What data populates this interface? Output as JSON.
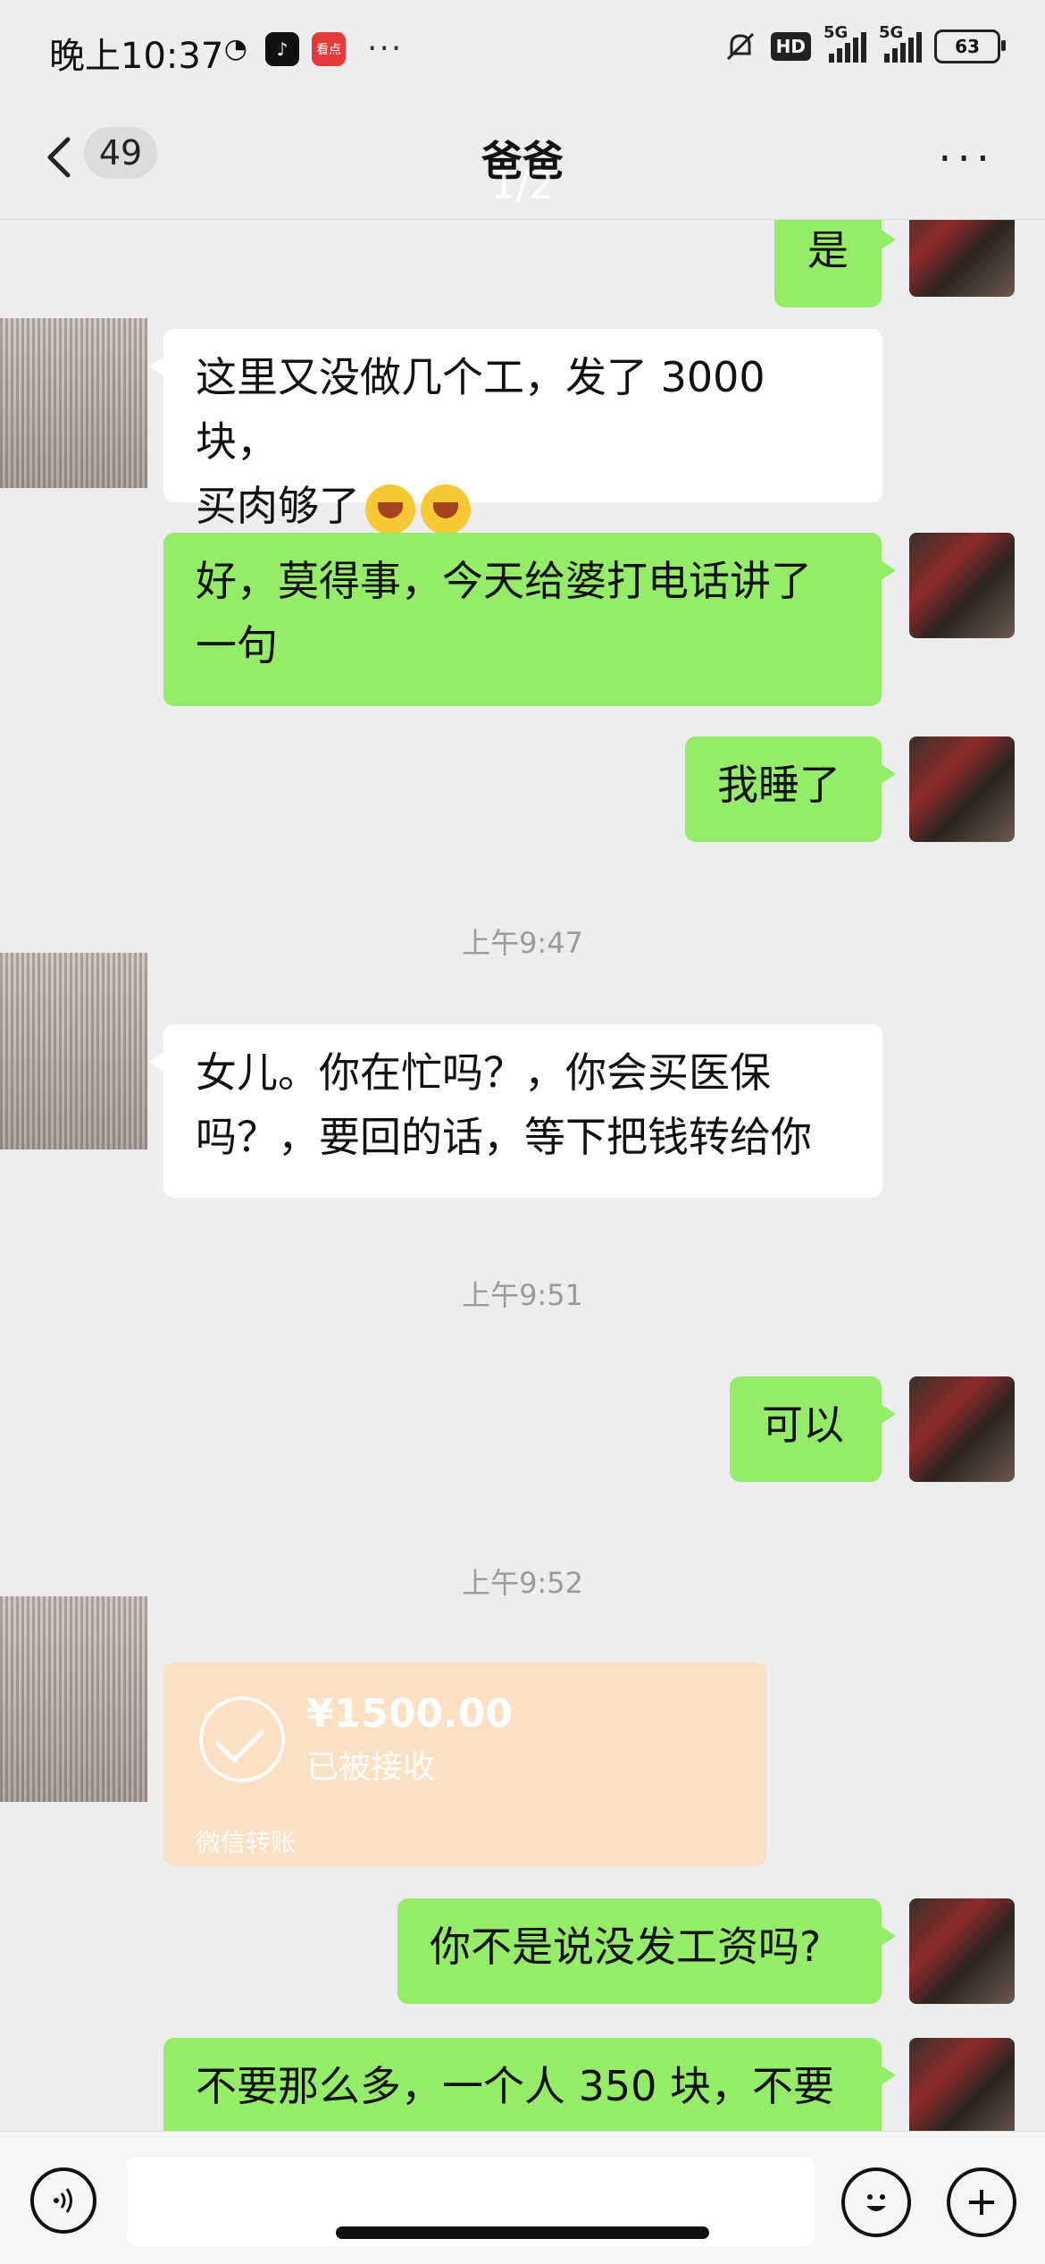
{
  "status_bar": {
    "time": "晚上10:37",
    "app_badge_kd": "看点",
    "more_dots": "···",
    "hd": "HD",
    "net1": "5G",
    "net2": "5G",
    "battery": "63"
  },
  "header": {
    "back_count": "49",
    "title": "爸爸",
    "pager": "1/2",
    "more": "···"
  },
  "messages": {
    "m1": "是",
    "m2_line1": "这里又没做几个工，发了 3000 块，",
    "m2_line2": "买肉够了",
    "m3_line1": "好，莫得事，今天给婆打电话讲了",
    "m3_line2": "一句",
    "m4": "我睡了",
    "t1": "上午9:47",
    "m5_line1": "女儿。你在忙吗？，你会买医保",
    "m5_line2": "吗？，要回的话，等下把钱转给你",
    "t2": "上午9:51",
    "m6": "可以",
    "t3": "上午9:52",
    "m8": "你不是说没发工资吗?",
    "m9": "不要那么多，一个人 350 块，不要"
  },
  "transfer": {
    "amount": "¥1500.00",
    "status": "已被接收",
    "label": "微信转账"
  },
  "colors": {
    "my_bubble": "#95ec69",
    "their_bubble": "#ffffff",
    "transfer_bg": "#fbe0c4",
    "background": "#ededed"
  }
}
